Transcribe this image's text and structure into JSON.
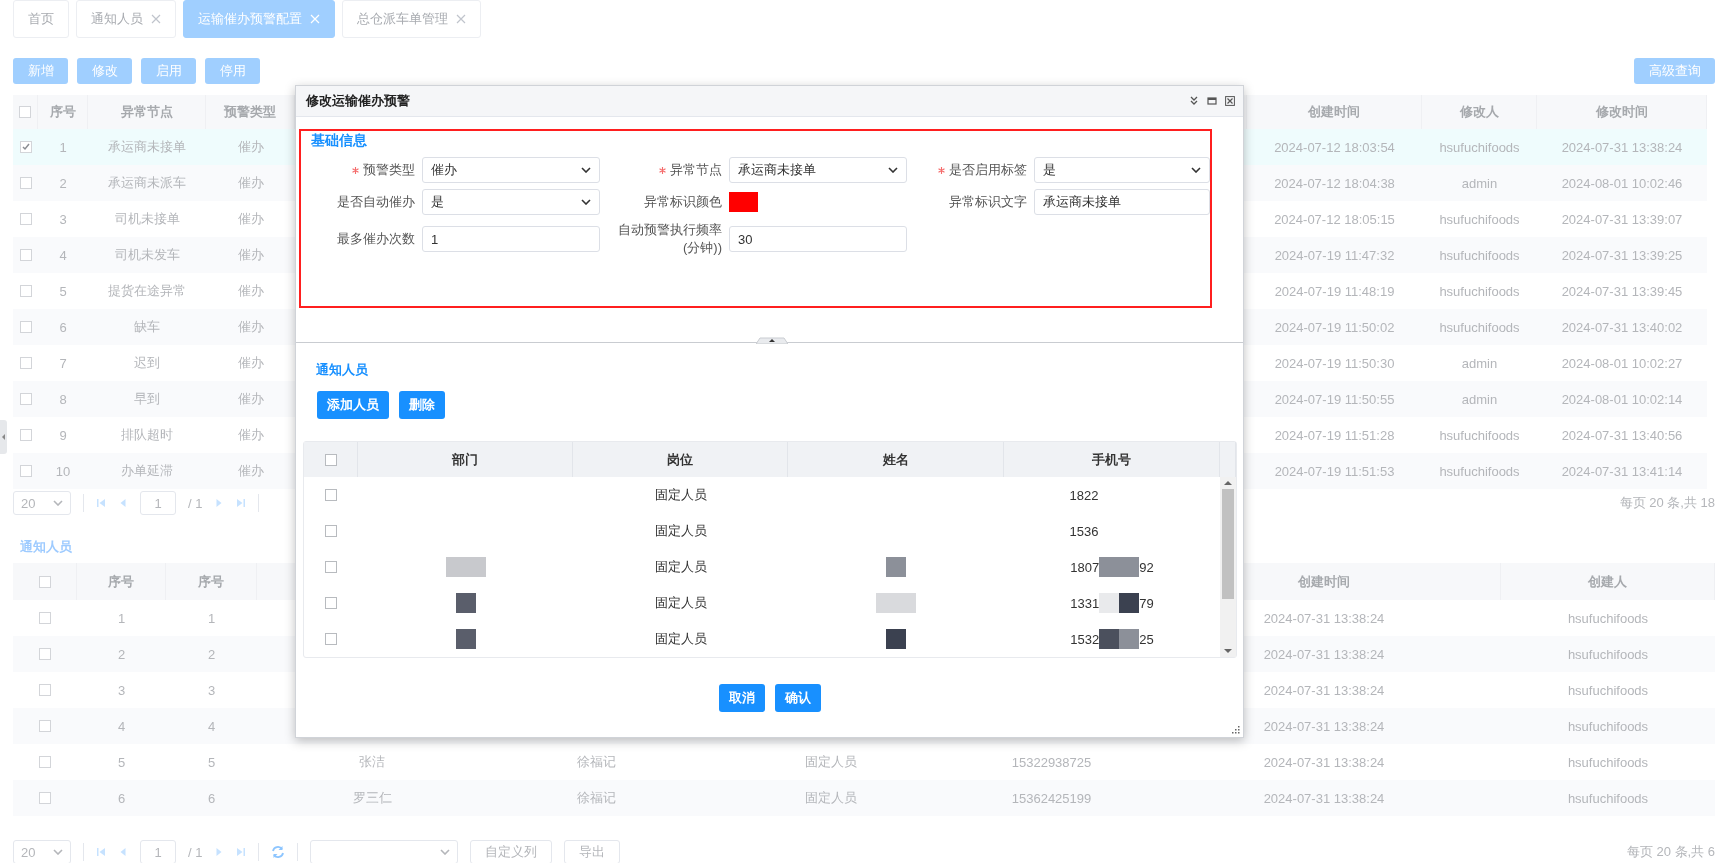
{
  "tabs": [
    {
      "label": "首页",
      "closable": false,
      "selected": false
    },
    {
      "label": "通知人员",
      "closable": true,
      "selected": false
    },
    {
      "label": "运输催办预警配置",
      "closable": true,
      "selected": true
    },
    {
      "label": "总仓派车单管理",
      "closable": true,
      "selected": false
    }
  ],
  "toolbar": {
    "buttons": [
      "新增",
      "修改",
      "启用",
      "停用"
    ],
    "advanced_search": "高级查询"
  },
  "main_table": {
    "all_checked": false,
    "columns": [
      "序号",
      "异常节点",
      "预警类型",
      "创建时间",
      "修改人",
      "修改时间"
    ],
    "rows": [
      {
        "checked": true,
        "seq": "1",
        "node": "承运商未接单",
        "type": "催办",
        "created_at": "2024-07-12 18:03:54",
        "modifier": "hsufuchifoods",
        "modified_at": "2024-07-31 13:38:24"
      },
      {
        "checked": false,
        "seq": "2",
        "node": "承运商未派车",
        "type": "催办",
        "created_at": "2024-07-12 18:04:38",
        "modifier": "admin",
        "modified_at": "2024-08-01 10:02:46"
      },
      {
        "checked": false,
        "seq": "3",
        "node": "司机未接单",
        "type": "催办",
        "created_at": "2024-07-12 18:05:15",
        "modifier": "hsufuchifoods",
        "modified_at": "2024-07-31 13:39:07"
      },
      {
        "checked": false,
        "seq": "4",
        "node": "司机未发车",
        "type": "催办",
        "created_at": "2024-07-19 11:47:32",
        "modifier": "hsufuchifoods",
        "modified_at": "2024-07-31 13:39:25"
      },
      {
        "checked": false,
        "seq": "5",
        "node": "提货在途异常",
        "type": "催办",
        "created_at": "2024-07-19 11:48:19",
        "modifier": "hsufuchifoods",
        "modified_at": "2024-07-31 13:39:45"
      },
      {
        "checked": false,
        "seq": "6",
        "node": "缺车",
        "type": "催办",
        "created_at": "2024-07-19 11:50:02",
        "modifier": "hsufuchifoods",
        "modified_at": "2024-07-31 13:40:02"
      },
      {
        "checked": false,
        "seq": "7",
        "node": "迟到",
        "type": "催办",
        "created_at": "2024-07-19 11:50:30",
        "modifier": "admin",
        "modified_at": "2024-08-01 10:02:27"
      },
      {
        "checked": false,
        "seq": "8",
        "node": "早到",
        "type": "催办",
        "created_at": "2024-07-19 11:50:55",
        "modifier": "admin",
        "modified_at": "2024-08-01 10:02:14"
      },
      {
        "checked": false,
        "seq": "9",
        "node": "排队超时",
        "type": "催办",
        "created_at": "2024-07-19 11:51:28",
        "modifier": "hsufuchifoods",
        "modified_at": "2024-07-31 13:40:56"
      },
      {
        "checked": false,
        "seq": "10",
        "node": "办单延滞",
        "type": "催办",
        "created_at": "2024-07-19 11:51:53",
        "modifier": "hsufuchifoods",
        "modified_at": "2024-07-31 13:41:14"
      }
    ]
  },
  "main_pager": {
    "page_size": "20",
    "page": "1",
    "total_pages": "/ 1",
    "summary": "每页 20 条,共 18"
  },
  "notify_section": {
    "title": "通知人员",
    "table": {
      "all_checked": false,
      "columns_left": [
        "序号",
        "序号"
      ],
      "columns_right": [
        "创建时间",
        "创建人"
      ],
      "rows": [
        {
          "checked": false,
          "seq": "1",
          "seq_2": "1",
          "created_at": "2024-07-31 13:38:24",
          "creator": "hsufuchifoods"
        },
        {
          "checked": false,
          "seq": "2",
          "seq_2": "2",
          "created_at": "2024-07-31 13:38:24",
          "creator": "hsufuchifoods"
        },
        {
          "checked": false,
          "seq": "3",
          "seq_2": "3",
          "created_at": "2024-07-31 13:38:24",
          "creator": "hsufuchifoods"
        },
        {
          "checked": false,
          "seq": "4",
          "seq_2": "4",
          "created_at": "2024-07-31 13:38:24",
          "creator": "hsufuchifoods"
        },
        {
          "checked": false,
          "seq": "5",
          "seq_2": "5",
          "column_4": "张洁",
          "column_5": "徐福记",
          "column_6": "固定人员",
          "column_7": "15322938725",
          "created_at": "2024-07-31 13:38:24",
          "creator": "hsufuchifoods"
        },
        {
          "checked": false,
          "seq": "6",
          "seq_2": "6",
          "column_4": "罗三仁",
          "column_5": "徐福记",
          "column_6": "固定人员",
          "column_7": "15362425199",
          "created_at": "2024-07-31 13:38:24",
          "creator": "hsufuchifoods"
        }
      ]
    }
  },
  "bottom_pager": {
    "page_size": "20",
    "page": "1",
    "total_pages": "/ 1",
    "buttons": [
      "自定义列",
      "导出"
    ],
    "summary": "每页 20 条,共 6"
  },
  "dialog": {
    "title": "修改运输催办预警",
    "form": {
      "title": "基础信息",
      "fields": [
        {
          "kind": "select",
          "label": "预警类型",
          "required": true,
          "value": "催办"
        },
        {
          "kind": "select",
          "label": "异常节点",
          "required": true,
          "value": "承运商未接单"
        },
        {
          "kind": "select",
          "label": "是否启用标签",
          "required": true,
          "value": "是"
        },
        {
          "kind": "select",
          "label": "是否自动催办",
          "required": false,
          "value": "是"
        },
        {
          "kind": "color",
          "label": "异常标识颜色",
          "required": false,
          "color": "#ff0000"
        },
        {
          "kind": "text",
          "label": "异常标识文字",
          "required": false,
          "value": "承运商未接单"
        },
        {
          "kind": "text",
          "label": "最多催办次数",
          "required": false,
          "value": "1"
        },
        {
          "kind": "text",
          "label": "自动预警执行频率(分钟))",
          "required": false,
          "value": "30"
        }
      ]
    },
    "notify": {
      "title": "通知人员",
      "buttons": [
        "添加人员",
        "删除"
      ],
      "table": {
        "all_checked": false,
        "columns": [
          "部门",
          "岗位",
          "姓名",
          "手机号"
        ],
        "rows": [
          {
            "checked": false,
            "position": "固定人员",
            "phone_head": "1822"
          },
          {
            "checked": false,
            "position": "固定人员",
            "phone_head": "1536"
          },
          {
            "checked": false,
            "position": "固定人员",
            "phone_head": "1807",
            "phone_tail": "92",
            "masks": {
              "dept": [
                {
                  "color": "#c8c9cd"
                },
                {
                  "color": "#c8c9cd"
                }
              ],
              "name": [
                {
                  "color": "#8c9099"
                }
              ],
              "phone": [
                {
                  "color": "#8c9099"
                },
                {
                  "color": "#8c9099"
                }
              ]
            }
          },
          {
            "checked": false,
            "position": "固定人员",
            "phone_head": "1331",
            "phone_tail": "79",
            "masks": {
              "dept": [
                {
                  "color": "#5a5e6b"
                }
              ],
              "name": [
                {
                  "color": "#d9dadd"
                },
                {
                  "color": "#d9dadd"
                }
              ],
              "phone": [
                {
                  "color": "#e9eaec"
                },
                {
                  "color": "#3b4150"
                }
              ]
            }
          },
          {
            "checked": false,
            "position": "固定人员",
            "phone_head": "1532",
            "phone_tail": "25",
            "masks": {
              "dept": [
                {
                  "color": "#5a5e6b"
                }
              ],
              "name": [
                {
                  "color": "#3b4150"
                }
              ],
              "phone": [
                {
                  "color": "#4b505d"
                },
                {
                  "color": "#8c9099"
                }
              ]
            }
          }
        ]
      }
    },
    "footer_buttons": [
      "取消",
      "确认"
    ]
  }
}
